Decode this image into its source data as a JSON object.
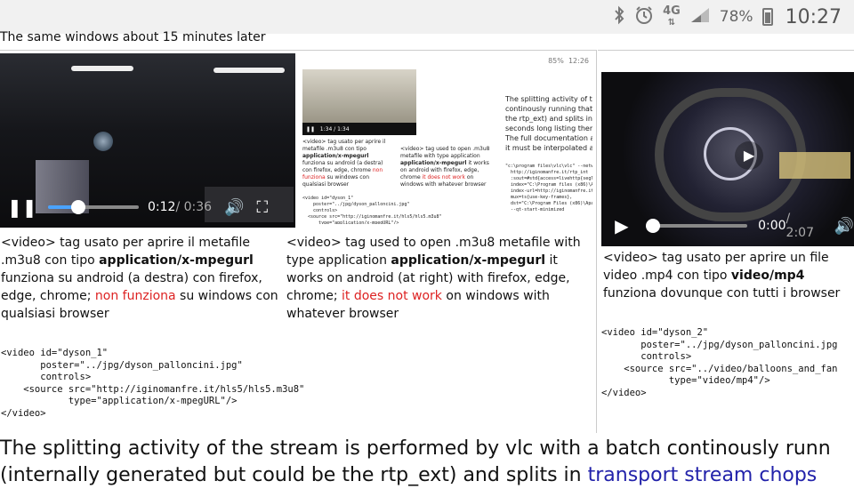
{
  "status_bar": {
    "network": "4G",
    "battery_pct": "78%",
    "time": "10:27"
  },
  "caption": "The same windows about 15 minutes later",
  "video1": {
    "current": "0:12",
    "total": " / 0:36",
    "progress": 0.33
  },
  "video3": {
    "current": "0:00",
    "total": " / 2:07",
    "progress": 0.0
  },
  "thumb": {
    "status_pct": "85%",
    "status_time": "12:26",
    "video_time": "1:34 / 1:34",
    "it_text_pre": "<video> tag usato per aprire il metafile .m3u8",
    "it_text_mid": "con tipo ",
    "it_text_bold": "application/x-mpegurl",
    "it_text_post": " funziona su android (a destra) con firefox, edge, chrome",
    "it_text_red": "non funziona",
    "it_text_end": " su windows con qualsiasi browser",
    "en_text_pre": "<video> tag used to open .m3u8 metafile with type application ",
    "en_text_bold": "application/x-mpegurl",
    "en_text_post": " it works on android with firefox, edge, chrome ",
    "en_text_red": "it does not work",
    "en_text_end": " on windows with whatever browser",
    "code": "<video id=\"dyson_1\"\n    poster=\"../jpg/dyson_palloncini.jpg\"\n    controls>\n  <source src=\"http://iginomanfre.it/hls5/hls5.m3u8\"\n      type=\"application/x-mpegURL\"/>\n</video>",
    "right_text": "The splitting activity of the\ncontinously running that i\nthe rtp_ext) and splits in t\nseconds long listing them\nThe full documentation at\nit must be interpolated an",
    "right_code": "\"c:\\program files\\vlc\\vlc\" --network-c\n  http://iginomanfre.it/rtp_int\n  :sout=#std{access=livehttp{seglen\n  index=\"C:\\Program files (x86)\\Apa\n  index-url=http://iginomanfre.it/h\n  mux=ts{use-key-frames},\n  dst=\"C:\\Program Files (x86)\\Apach\n  --qt-start-minimized"
  },
  "para1": {
    "t1": "<video> tag usato per aprire il metafile .m3u8",
    "t2": "con tipo ",
    "bold": "application/x-mpegurl",
    "t3": " funziona su android (a destra) con firefox, edge, chrome;",
    "red": "non funziona",
    "t4": " su windows con qualsiasi browser"
  },
  "para2": {
    "t1": "<video> tag used to open .m3u8 metafile with type application ",
    "bold": "application/x-mpegurl",
    "t2": " it works on android (at right) with firefox, edge, chrome; ",
    "red": "it does not work",
    "t3": " on windows with whatever browser"
  },
  "para3": {
    "t1": "<video> tag usato per aprire un file video .mp4 con tipo ",
    "bold": "video/mp4",
    "t2": " funziona dovunque con tutti i browser"
  },
  "code1": "<video id=\"dyson_1\"\n       poster=\"../jpg/dyson_palloncini.jpg\"\n       controls>\n    <source src=\"http://iginomanfre.it/hls5/hls5.m3u8\"\n            type=\"application/x-mpegURL\"/>\n</video>",
  "code2": "<video id=\"dyson_2\"\n       poster=\"../jpg/dyson_palloncini.jpg\n       controls>\n    <source src=\"../video/balloons_and_fan\n            type=\"video/mp4\"/>\n</video>",
  "bottom": {
    "line1": "The splitting activity of the stream is performed by vlc with a batch continously runn",
    "line2_pre": "(internally generated but could be the rtp_ext) and splits in ",
    "line2_link": "transport stream chops"
  }
}
